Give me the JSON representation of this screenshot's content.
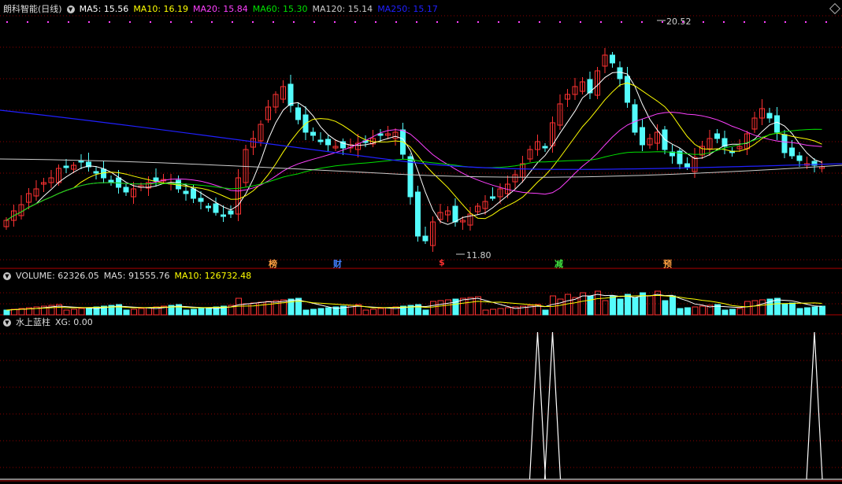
{
  "kline_header": {
    "stock": "朗科智能(日线)",
    "ma5": {
      "label": "MA5: 15.56",
      "color": "#ffffff"
    },
    "ma10": {
      "label": "MA10: 16.19",
      "color": "#ffff00"
    },
    "ma20": {
      "label": "MA20: 15.84",
      "color": "#ff40ff"
    },
    "ma60": {
      "label": "MA60: 15.30",
      "color": "#00e000"
    },
    "ma120": {
      "label": "MA120: 15.14",
      "color": "#cccccc"
    },
    "ma250": {
      "label": "MA250: 15.17",
      "color": "#2020ff"
    }
  },
  "price_labels": {
    "high": "20.52",
    "low": "11.80"
  },
  "event_markers": [
    "榜",
    "财",
    "$",
    "减",
    "预"
  ],
  "volume_header": {
    "volume": "VOLUME: 62326.05",
    "ma5": "MA5: 91555.76",
    "ma10": "MA10: 126732.48"
  },
  "indicator_header": {
    "name": "水上蓝柱",
    "xg": "XG: 0.00"
  },
  "colors": {
    "up": "#ff3232",
    "down": "#54fcfc",
    "grid": "#8b0000",
    "axis": "#b00000"
  },
  "xg_signal_bars": [
    71,
    73,
    108,
    114
  ]
}
